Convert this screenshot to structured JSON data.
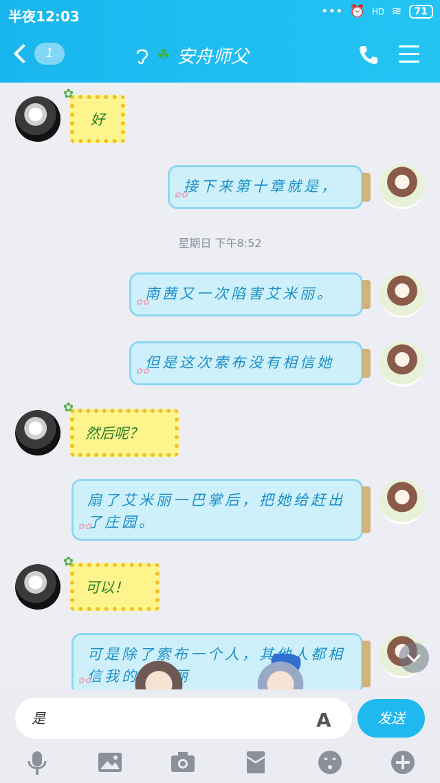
{
  "status_bar": {
    "time": "半夜12:03",
    "signal_text": "HD",
    "battery": "71"
  },
  "header": {
    "back_badge": "1",
    "title": "安舟师父"
  },
  "messages": [
    {
      "side": "left",
      "text": "好"
    },
    {
      "side": "right",
      "text": "接下来第十章就是，"
    },
    {
      "side": "right",
      "text": "南茜又一次陷害艾米丽。"
    },
    {
      "side": "right",
      "text": "但是这次索布没有相信她"
    },
    {
      "side": "left",
      "text": "然后呢？"
    },
    {
      "side": "right",
      "text": "扇了艾米丽一巴掌后，把她给赶出了庄园。"
    },
    {
      "side": "left",
      "text": "可以！"
    },
    {
      "side": "right",
      "text": "可是除了索布一个人，其他人都相信我的艾米丽"
    }
  ],
  "timestamp": "星期日 下午8:52",
  "input": {
    "value": "是",
    "send_label": "发送"
  },
  "toolbar": [
    "mic-icon",
    "image-icon",
    "camera-icon",
    "red-packet-icon",
    "emoji-icon",
    "plus-icon"
  ]
}
